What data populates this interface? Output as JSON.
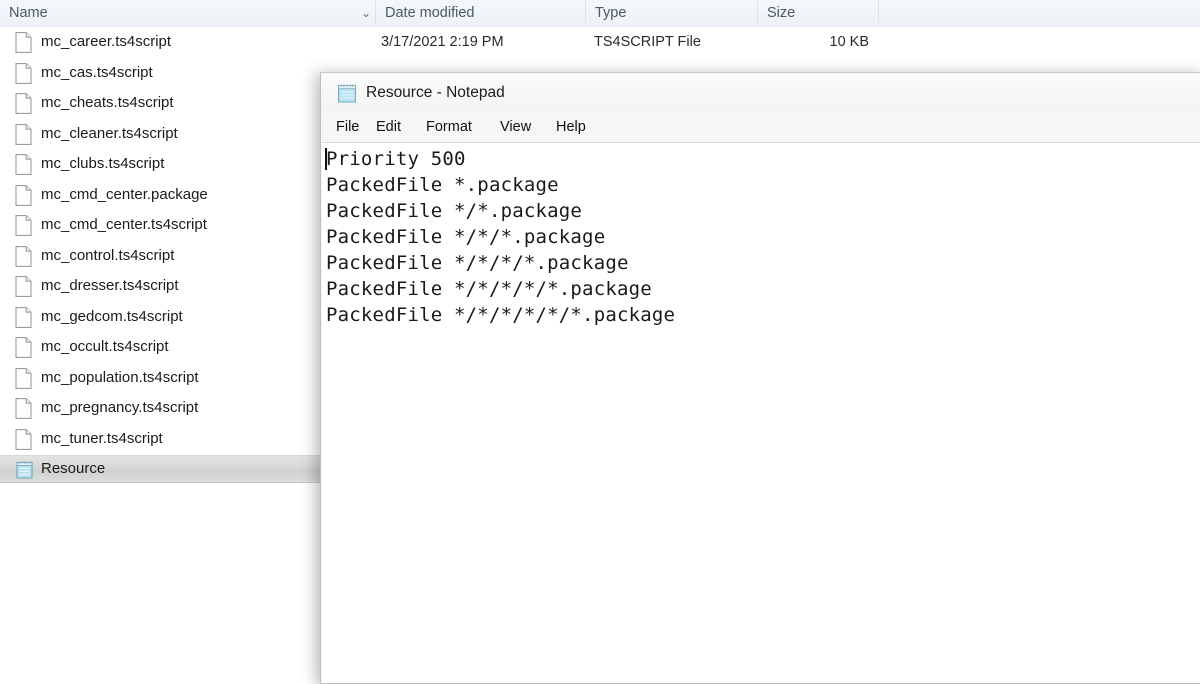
{
  "explorer": {
    "columns": [
      {
        "label": "Name",
        "key": "name"
      },
      {
        "label": "Date modified",
        "key": "date"
      },
      {
        "label": "Type",
        "key": "type"
      },
      {
        "label": "Size",
        "key": "size"
      }
    ],
    "sort_chevron": "⌄",
    "rows": [
      {
        "name": "mc_career.ts4script",
        "date": "3/17/2021 2:19 PM",
        "type": "TS4SCRIPT File",
        "size": "10 KB",
        "icon": "file-icon",
        "selected": false
      },
      {
        "name": "mc_cas.ts4script",
        "date": "",
        "type": "",
        "size": "",
        "icon": "file-icon",
        "selected": false
      },
      {
        "name": "mc_cheats.ts4script",
        "date": "",
        "type": "",
        "size": "",
        "icon": "file-icon",
        "selected": false
      },
      {
        "name": "mc_cleaner.ts4script",
        "date": "",
        "type": "",
        "size": "",
        "icon": "file-icon",
        "selected": false
      },
      {
        "name": "mc_clubs.ts4script",
        "date": "",
        "type": "",
        "size": "",
        "icon": "file-icon",
        "selected": false
      },
      {
        "name": "mc_cmd_center.package",
        "date": "",
        "type": "",
        "size": "",
        "icon": "file-icon",
        "selected": false
      },
      {
        "name": "mc_cmd_center.ts4script",
        "date": "",
        "type": "",
        "size": "",
        "icon": "file-icon",
        "selected": false
      },
      {
        "name": "mc_control.ts4script",
        "date": "",
        "type": "",
        "size": "",
        "icon": "file-icon",
        "selected": false
      },
      {
        "name": "mc_dresser.ts4script",
        "date": "",
        "type": "",
        "size": "",
        "icon": "file-icon",
        "selected": false
      },
      {
        "name": "mc_gedcom.ts4script",
        "date": "",
        "type": "",
        "size": "",
        "icon": "file-icon",
        "selected": false
      },
      {
        "name": "mc_occult.ts4script",
        "date": "",
        "type": "",
        "size": "",
        "icon": "file-icon",
        "selected": false
      },
      {
        "name": "mc_population.ts4script",
        "date": "",
        "type": "",
        "size": "",
        "icon": "file-icon",
        "selected": false
      },
      {
        "name": "mc_pregnancy.ts4script",
        "date": "",
        "type": "",
        "size": "",
        "icon": "file-icon",
        "selected": false
      },
      {
        "name": "mc_tuner.ts4script",
        "date": "",
        "type": "",
        "size": "",
        "icon": "file-icon",
        "selected": false
      },
      {
        "name": "Resource",
        "date": "",
        "type": "",
        "size": "",
        "icon": "notepad-icon",
        "selected": true
      }
    ]
  },
  "notepad": {
    "title": "Resource - Notepad",
    "app_icon": "notepad-icon",
    "menu": [
      "File",
      "Edit",
      "Format",
      "View",
      "Help"
    ],
    "content": "Priority 500\nPackedFile *.package\nPackedFile */*.package\nPackedFile */*/*.package\nPackedFile */*/*/*.package\nPackedFile */*/*/*/*.package\nPackedFile */*/*/*/*/*.package"
  },
  "colors": {
    "header_bg": "#eef2f7",
    "header_text": "#4a5a6a",
    "selection": "#d6d6d6",
    "window_border": "#bfbfbf",
    "text": "#1a1a1a"
  }
}
